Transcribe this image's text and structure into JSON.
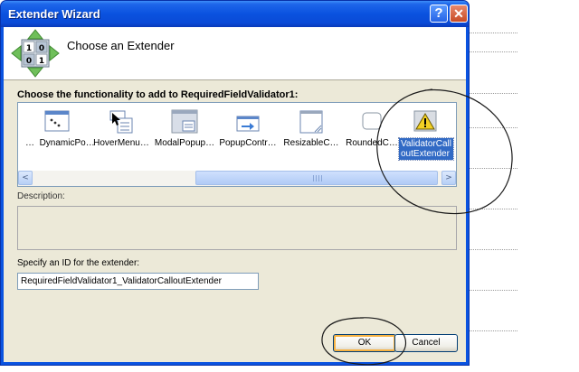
{
  "window": {
    "title": "Extender Wizard",
    "help_symbol": "?",
    "close_symbol": "✕"
  },
  "header": {
    "title": "Choose an Extender",
    "icon": "binary-matrix-icon"
  },
  "functionality_label": "Choose the functionality to add to RequiredFieldValidator1:",
  "extenders": [
    {
      "label": "DynamicPo…",
      "icon": "dynamic-populate-icon",
      "prefix": "…"
    },
    {
      "label": "HoverMenu…",
      "icon": "hover-menu-icon"
    },
    {
      "label": "ModalPopup…",
      "icon": "modal-popup-icon"
    },
    {
      "label": "PopupContr…",
      "icon": "popup-control-icon"
    },
    {
      "label": "ResizableC…",
      "icon": "resizable-control-icon"
    },
    {
      "label": "RoundedC…",
      "icon": "rounded-corners-icon"
    },
    {
      "label": "ValidatorCalloutExtender",
      "icon": "warning-triangle-icon",
      "selected": true
    }
  ],
  "scrollbar": {
    "left_arrow": "<",
    "right_arrow": ">"
  },
  "description_label": "Description:",
  "description_text": "",
  "id_label": "Specify an ID for the extender:",
  "id_value": "RequiredFieldValidator1_ValidatorCalloutExtender",
  "buttons": {
    "ok": "OK",
    "cancel": "Cancel"
  },
  "colors": {
    "titlebar": "#0a52df",
    "client_bg": "#ece9d8",
    "selection": "#316ac5",
    "annotation_ink": "#1a1a1a"
  }
}
